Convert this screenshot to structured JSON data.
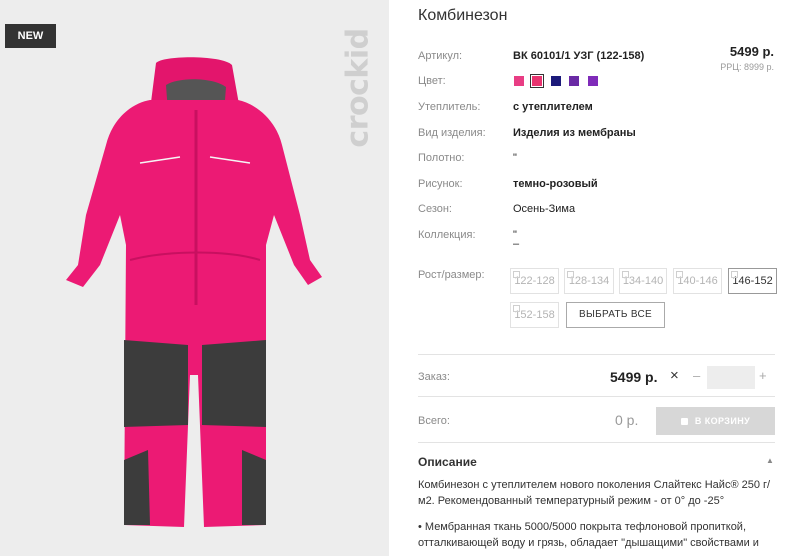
{
  "photo": {
    "badge": "NEW",
    "brand": "crockid"
  },
  "product": {
    "title": "Комбинезон",
    "price": "5499 р.",
    "rrp": "РРЦ: 8999 р.",
    "attributes": [
      {
        "label": "Артикул:",
        "value": "ВК 60101/1 УЗГ (122-158)",
        "bold": true
      },
      {
        "label": "Цвет:",
        "value": ""
      },
      {
        "label": "Утеплитель:",
        "value": "с утеплителем",
        "bold": true
      },
      {
        "label": "Вид изделия:",
        "value": "Изделия из мембраны",
        "bold": true
      },
      {
        "label": "Полотно:",
        "value": "\""
      },
      {
        "label": "Рисунок:",
        "value": "темно-розовый",
        "bold": true
      },
      {
        "label": "Сезон:",
        "value": "Осень-Зима"
      },
      {
        "label": "Коллекция:",
        "value": "\""
      },
      {
        "label": "Рост/размер:",
        "value": ""
      }
    ],
    "colors": [
      "#e83d84",
      "#e8336f",
      "#1c1a7a",
      "#6a2aa5",
      "#7f2bb9"
    ],
    "selected_color_index": 1,
    "collection_dash": "–"
  },
  "sizes": {
    "options": [
      "122-128",
      "128-134",
      "134-140",
      "140-146",
      "146-152",
      "152-158"
    ],
    "active": "146-152",
    "select_all": "ВЫБРАТЬ ВСЕ"
  },
  "order": {
    "label": "Заказ:",
    "price": "5499 р.",
    "times": "×",
    "minus": "–",
    "plus": "+",
    "quantity": ""
  },
  "total": {
    "label": "Всего:",
    "value": "0 р.",
    "cart_button": "В КОРЗИНУ"
  },
  "description": {
    "title": "Описание",
    "paragraph1": "Комбинезон с утеплителем нового поколения Слайтекс Найс® 250 г/м2. Рекомендованный температурный режим - от 0° до -25°",
    "paragraph2": "• Мембранная ткань 5000/5000 покрыта тефлоновой пропиткой, отталкивающей воду и грязь, обладает \"дышащими\" свойствами и"
  }
}
